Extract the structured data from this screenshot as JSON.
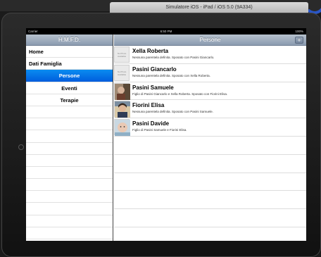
{
  "simulator": {
    "title": "Simulatore iOS - iPad / iOS 5.0 (9A334)"
  },
  "statusbar": {
    "carrier": "Carrier",
    "time": "6:50 PM",
    "battery": "100%"
  },
  "master": {
    "title": "H.M.F.D.",
    "items": [
      {
        "label": "Home",
        "indent": false,
        "selected": false
      },
      {
        "label": "Dati Famiglia",
        "indent": false,
        "selected": false
      },
      {
        "label": "Persone",
        "indent": true,
        "selected": true
      },
      {
        "label": "Eventi",
        "indent": true,
        "selected": false
      },
      {
        "label": "Terapie",
        "indent": true,
        "selected": false
      }
    ]
  },
  "detail": {
    "title": "Persone",
    "add_label": "+",
    "people": [
      {
        "name": "Xella Roberta",
        "description": "Nessuna parentela definita. Sposato con Pasini Giancarlo.",
        "photo": "No Photo Available"
      },
      {
        "name": "Pasini Giancarlo",
        "description": "Nessuna parentela definita. Sposato con Xella Roberta.",
        "photo": "No Photo Available"
      },
      {
        "name": "Pasini Samuele",
        "description": "Figlio di Pasini Giancarlo e Xella Roberta. Sposato con Fiorini Elisa.",
        "photo": ""
      },
      {
        "name": "Fiorini Elisa",
        "description": "Nessuna parentela definita. Sposato con Pasini Samuele.",
        "photo": ""
      },
      {
        "name": "Pasini Davide",
        "description": "Figlio di Pasini Samuele e Fiorini Elisa.",
        "photo": ""
      }
    ]
  }
}
